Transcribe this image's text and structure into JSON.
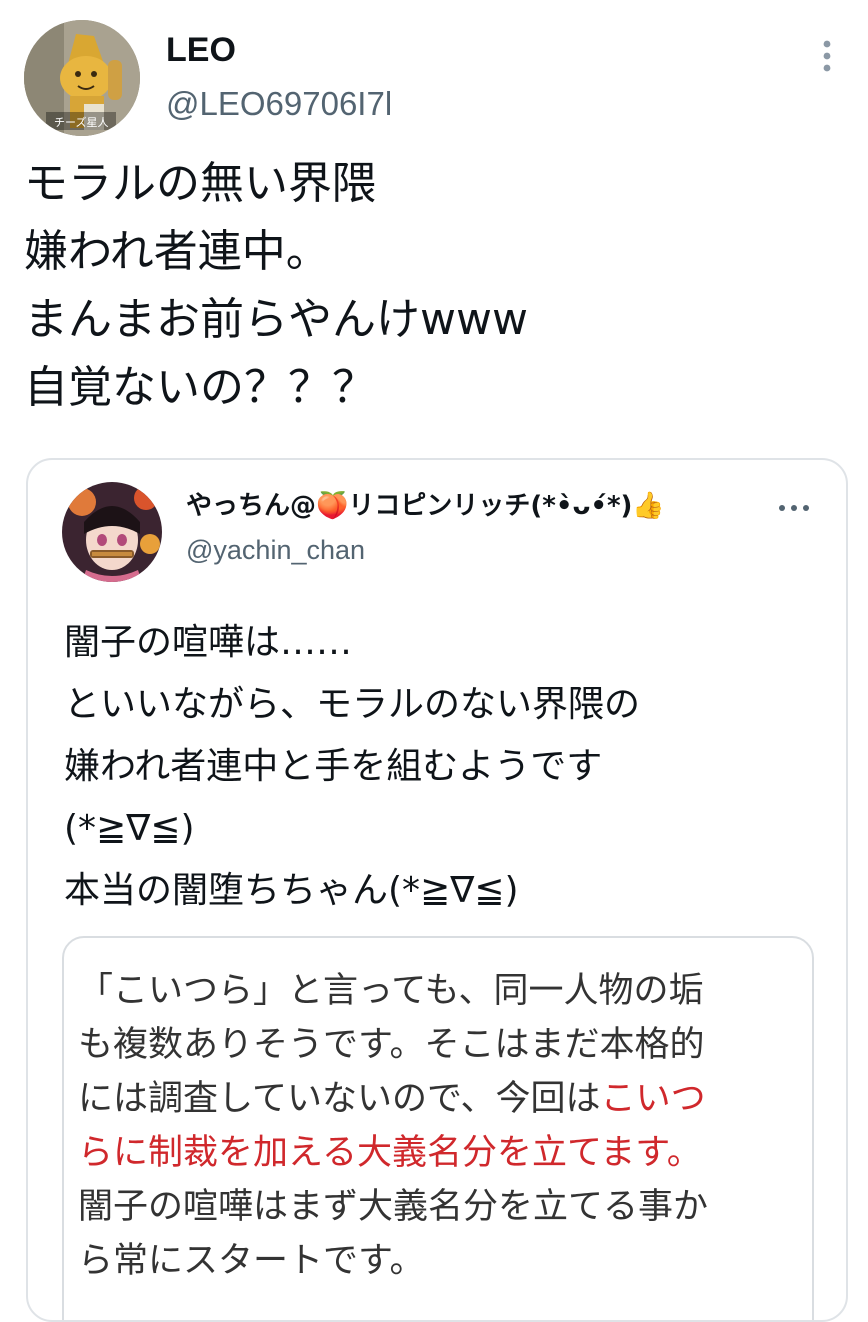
{
  "tweet": {
    "author_name": "LEO",
    "author_handle": "@LEO69706I7l",
    "avatar_caption": "チーズ星人",
    "more_icon": "more-vertical-icon",
    "lines": [
      "モラルの無い界隈",
      "嫌われ者連中。",
      "まんまお前らやんけwww",
      "自覚ないの？？？"
    ]
  },
  "quote": {
    "author_name": "やっちん@🍑リコピンリッチ(*•̀ᴗ•́*)👍",
    "author_handle": "@yachin_chan",
    "more_icon": "more-horizontal-icon",
    "lines": [
      "闇子の喧嘩は……",
      "といいながら、モラルのない界隈の",
      "嫌われ者連中と手を組むようです",
      "(*≧∇≦)",
      "本当の闇堕ちちゃん(*≧∇≦)"
    ],
    "embedded_image": {
      "lines": [
        {
          "black": "「こいつら」と言っても、同一人物の垢",
          "red": ""
        },
        {
          "black": "も複数ありそうです。そこはまだ本格的",
          "red": ""
        },
        {
          "black": "には調査していないので、今回は",
          "red": "こいつ"
        },
        {
          "black": "",
          "red": "らに制裁を加える大義名分を立てます。"
        },
        {
          "black": "闇子の喧嘩はまず大義名分を立てる事か",
          "red": ""
        },
        {
          "black": "ら常にスタートです。",
          "red": ""
        }
      ]
    }
  },
  "colors": {
    "text": "#0f1419",
    "secondary": "#536471",
    "border": "#dfe3e7",
    "highlight_red": "#d0282c"
  }
}
